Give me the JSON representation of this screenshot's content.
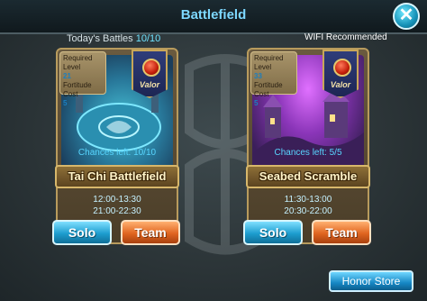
{
  "header": {
    "title": "Battlefield"
  },
  "status": {
    "todays_battles_label": "Today's Battles",
    "todays_battles_value": "10/10",
    "wifi_note": "WIFI Recommended"
  },
  "battlefields": [
    {
      "required_level_label": "Required Level",
      "required_level": "21",
      "fortitude_cost_label": "Fortitude Cost",
      "fortitude_cost": "5",
      "badge_text": "Valor",
      "chances_left_label": "Chances left:",
      "chances_left": "10/10",
      "name": "Tai Chi Battlefield",
      "time_1": "12:00-13:30",
      "time_2": "21:00-22:30",
      "solo_label": "Solo",
      "team_label": "Team"
    },
    {
      "required_level_label": "Required Level",
      "required_level": "33",
      "fortitude_cost_label": "Fortitude Cost",
      "fortitude_cost": "5",
      "badge_text": "Valor",
      "chances_left_label": "Chances left:",
      "chances_left": "5/5",
      "name": "Seabed Scramble",
      "time_1": "11:30-13:00",
      "time_2": "20:30-22:00",
      "solo_label": "Solo",
      "team_label": "Team"
    }
  ],
  "footer": {
    "honor_store_label": "Honor Store"
  },
  "icons": {
    "close": "close-icon",
    "valor": "valor-badge-icon"
  },
  "colors": {
    "accent": "#58d6ff",
    "solo_button": "#1d9dcf",
    "team_button": "#e06520",
    "gold_frame": "#b89b5d"
  }
}
